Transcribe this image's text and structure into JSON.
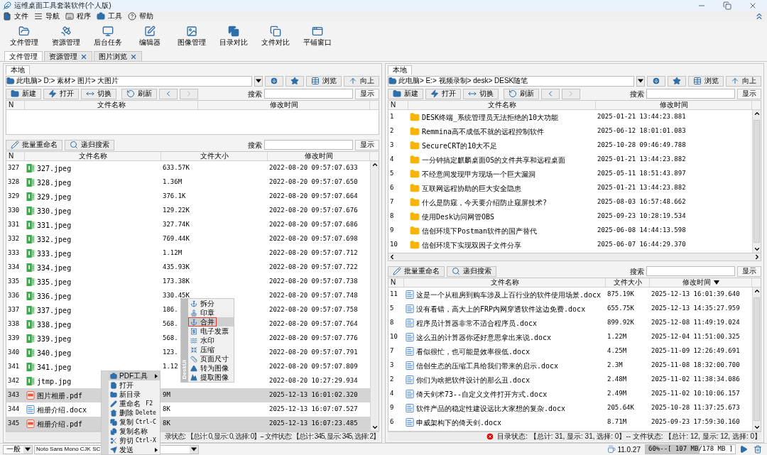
{
  "window": {
    "title": "运维桌面工具套装软件(个人版)"
  },
  "menu": [
    {
      "label": "文件",
      "kind": "file"
    },
    {
      "label": "导航",
      "kind": "nav"
    },
    {
      "label": "程序",
      "kind": "program"
    },
    {
      "label": "工具",
      "kind": "tools"
    },
    {
      "label": "帮助",
      "kind": "help"
    }
  ],
  "toolbar": [
    {
      "label": "文件管理",
      "kind": "folder"
    },
    {
      "label": "资源管理",
      "kind": "remote"
    },
    {
      "label": "后台任务",
      "kind": "monitor"
    },
    {
      "label": "编辑器",
      "kind": "editor"
    },
    {
      "label": "图像管理",
      "kind": "image"
    },
    {
      "label": "目录对比",
      "kind": "dircompare"
    },
    {
      "label": "文件对比",
      "kind": "filecompare"
    },
    {
      "label": "平铺窗口",
      "kind": "tile"
    }
  ],
  "tabs": [
    {
      "label": "文件管理",
      "selected": true,
      "closable": false
    },
    {
      "label": "资源管理",
      "selected": false,
      "closable": true
    },
    {
      "label": "图片浏览",
      "selected": false,
      "closable": true
    }
  ],
  "left_pane": {
    "tab": {
      "label": "本地",
      "selected": true
    },
    "path": "此电脑> D:> 素材> 图片> 大图片",
    "path_buttons": [
      {
        "label": "浏览",
        "kind": "browse"
      },
      {
        "label": "向上",
        "kind": "up"
      }
    ],
    "actions": [
      {
        "label": "新建",
        "kind": "new"
      },
      {
        "label": "打开",
        "kind": "open"
      },
      {
        "label": "切换",
        "kind": "switch"
      },
      {
        "label": "刷新",
        "kind": "refresh"
      }
    ],
    "nav": [
      {
        "kind": "back",
        "disabled": false
      },
      {
        "kind": "forward",
        "disabled": true
      }
    ],
    "search_label": "搜索",
    "show_button": "显示",
    "upper_table": {
      "columns": [
        {
          "label": "N",
          "kind": "n"
        },
        {
          "label": "文件名称",
          "kind": "name"
        },
        {
          "label": "修改时间",
          "kind": "time"
        }
      ]
    },
    "lower_tools": [
      {
        "label": "批量重命名",
        "kind": "rename"
      },
      {
        "label": "递归搜索",
        "kind": "search"
      }
    ],
    "lower_search_label": "搜索",
    "lower_show_button": "显示",
    "lower_table": {
      "columns": [
        {
          "label": "N",
          "kind": "n",
          "sorted": false
        },
        {
          "label": "文件名称",
          "kind": "name",
          "sorted": false
        },
        {
          "label": "文件大小",
          "kind": "size",
          "sorted": false
        },
        {
          "label": "修改时间",
          "kind": "time",
          "sorted": false
        }
      ],
      "rows": [
        {
          "n": "327",
          "name": "327.jpeg",
          "kind": "jpeg",
          "size": "633.57K",
          "time": "2022-08-20 09:57:07.633",
          "selected": false
        },
        {
          "n": "328",
          "name": "328.jpeg",
          "kind": "jpeg",
          "size": "1.36M",
          "time": "2022-08-20 09:57:07.650",
          "selected": false
        },
        {
          "n": "329",
          "name": "329.jpeg",
          "kind": "jpeg",
          "size": "376.1K",
          "time": "2022-08-20 09:57:07.664",
          "selected": false
        },
        {
          "n": "330",
          "name": "330.jpeg",
          "kind": "jpeg",
          "size": "129.22K",
          "time": "2022-08-20 09:57:07.676",
          "selected": false
        },
        {
          "n": "331",
          "name": "331.jpeg",
          "kind": "jpeg",
          "size": "327.74K",
          "time": "2022-08-20 09:57:07.686",
          "selected": false
        },
        {
          "n": "332",
          "name": "332.jpeg",
          "kind": "jpeg",
          "size": "769.44K",
          "time": "2022-08-20 09:57:07.698",
          "selected": false
        },
        {
          "n": "333",
          "name": "333.jpeg",
          "kind": "jpeg",
          "size": "1.12M",
          "time": "2022-08-20 09:57:07.712",
          "selected": false
        },
        {
          "n": "334",
          "name": "334.jpeg",
          "kind": "jpeg",
          "size": "435.93K",
          "time": "2022-08-20 09:57:07.722",
          "selected": false
        },
        {
          "n": "335",
          "name": "335.jpeg",
          "kind": "jpeg",
          "size": "173.38K",
          "time": "2022-08-20 09:57:07.738",
          "selected": false
        },
        {
          "n": "336",
          "name": "336.jpeg",
          "kind": "jpeg",
          "size": "330.45K",
          "time": "2022-08-20 09:57:07.748",
          "selected": false
        },
        {
          "n": "337",
          "name": "337.jpeg",
          "kind": "jpeg",
          "size": "186.",
          "time": "2022-08-20 09:57:07.758",
          "selected": false
        },
        {
          "n": "338",
          "name": "338.jpeg",
          "kind": "jpeg",
          "size": "568.",
          "time": "2022-08-20 09:57:07.764",
          "selected": false
        },
        {
          "n": "339",
          "name": "339.jpeg",
          "kind": "jpeg",
          "size": "568.",
          "time": "2022-08-20 09:57:07.776",
          "selected": false
        },
        {
          "n": "340",
          "name": "340.jpeg",
          "kind": "jpeg",
          "size": "123.",
          "time": "2022-08-20 09:57:07.791",
          "selected": false
        },
        {
          "n": "341",
          "name": "341.jpeg",
          "kind": "jpeg",
          "size": "1.12",
          "time": "2022-08-20 09:57:07.809",
          "selected": false
        },
        {
          "n": "342",
          "name": "jtmp.jpg",
          "kind": "jpeg",
          "time": "2022-08-20 10:27:29.934",
          "selected": false
        },
        {
          "n": "343",
          "name": "图片相册.pdf",
          "kind": "pdf",
          "size": "9M",
          "time": "2025-12-13 16:01:02.320",
          "selected": true
        },
        {
          "n": "344",
          "name": "相册介绍.docx",
          "kind": "docx",
          "size": "8K",
          "time": "2025-12-13 16:07:07.527",
          "selected": false
        },
        {
          "n": "345",
          "name": "相册介绍.pdf",
          "kind": "pdf",
          "size": "8K",
          "time": "2025-12-13 16:07:23.485",
          "selected": true
        }
      ]
    },
    "status": "录状态: 【总计: 0, 显示: 0, 选择: 0】-- 文件状态: 【总计: 345, 显示: 345, 选择: 2】",
    "status_error": false
  },
  "right_pane": {
    "tab": {
      "label": "本地",
      "selected": true
    },
    "path": "此电脑> E:> 视频录制> desk> DESK随笔",
    "path_buttons": [
      {
        "label": "浏览",
        "kind": "browse"
      },
      {
        "label": "向上",
        "kind": "up"
      }
    ],
    "actions": [
      {
        "label": "新建",
        "kind": "new"
      },
      {
        "label": "打开",
        "kind": "open"
      },
      {
        "label": "切换",
        "kind": "switch"
      },
      {
        "label": "刷新",
        "kind": "refresh"
      }
    ],
    "nav": [
      {
        "kind": "back",
        "disabled": false
      },
      {
        "kind": "forward",
        "disabled": true
      }
    ],
    "search_label": "搜索",
    "show_button": "显示",
    "upper_table": {
      "columns": [
        {
          "label": "N",
          "kind": "n"
        },
        {
          "label": "文件名称",
          "kind": "name"
        },
        {
          "label": "修改时间",
          "kind": "time"
        }
      ],
      "rows": [
        {
          "n": "1",
          "name": "DESK终端_系统管理员无法拒绝的10大功能",
          "kind": "folder",
          "time": "2025-01-21 13:44:23.881",
          "selected": false
        },
        {
          "n": "2",
          "name": "Remmina高不成低不就的远程控制软件",
          "kind": "folder",
          "time": "2025-06-12 18:01:01.083",
          "selected": false
        },
        {
          "n": "3",
          "name": "SecureCRT的10大不足",
          "kind": "folder",
          "time": "2025-10-28 09:46:49.788",
          "selected": false
        },
        {
          "n": "4",
          "name": "一分钟搞定麒麟桌面OS的文件共享和远程桌面",
          "kind": "folder",
          "time": "2025-01-21 13:44:23.882",
          "selected": false
        },
        {
          "n": "5",
          "name": "不经意间发现甲方现场一个巨大漏洞",
          "kind": "folder",
          "time": "2025-05-11 18:51:43.897",
          "selected": false
        },
        {
          "n": "6",
          "name": "互联网远程协助的巨大安全隐患",
          "kind": "folder",
          "time": "2025-01-21 13:44:23.882",
          "selected": false
        },
        {
          "n": "7",
          "name": "什么是防窥，今天要介绍防止窥屏技术?",
          "kind": "folder",
          "time": "2025-08-03 16:57:48.662",
          "selected": false
        },
        {
          "n": "8",
          "name": "使用Desk访问网管OBS",
          "kind": "folder",
          "time": "2025-09-23 10:28:19.534",
          "selected": false
        },
        {
          "n": "9",
          "name": "信创环境下Postman软件的国产替代",
          "kind": "folder",
          "time": "2025-06-08 14:44:13.598",
          "selected": false
        },
        {
          "n": "10",
          "name": "信创环境下实现双因子文件分享",
          "kind": "folder",
          "time": "2025-06-07 16:44:29.370",
          "selected": false
        }
      ]
    },
    "lower_tools": [
      {
        "label": "批量重命名",
        "kind": "rename"
      },
      {
        "label": "递归搜索",
        "kind": "search"
      }
    ],
    "lower_search_label": "搜索",
    "lower_show_button": "显示",
    "lower_table": {
      "columns": [
        {
          "label": "N",
          "kind": "n",
          "sorted": false
        },
        {
          "label": "文件名称",
          "kind": "name",
          "sorted": false
        },
        {
          "label": "文件大小",
          "kind": "size",
          "sorted": false
        },
        {
          "label": "修改时间",
          "kind": "time",
          "sorted": true
        }
      ],
      "rows": [
        {
          "n": "11",
          "name": "这是一个从租房到购车涉及上百行业的软件使用场景.docx",
          "kind": "docx",
          "size": "875.19K",
          "time": "2025-12-13 16:01:39.640",
          "selected": false
        },
        {
          "n": "5",
          "name": "没有看错，高大上的FRP内网穿透软件这边免费.docx",
          "kind": "docx",
          "size": "655.75K",
          "time": "2025-12-13 14:35:27.959",
          "selected": false
        },
        {
          "n": "8",
          "name": "程序员计算器非常不适合程序员.docx",
          "kind": "docx",
          "size": "899.92K",
          "time": "2025-12-08 11:49:19.024",
          "selected": false
        },
        {
          "n": "10",
          "name": "这么丑的计算器你还好意思拿出来说.docx",
          "kind": "docx",
          "size": "1.22M",
          "time": "2025-12-04 11:51:00.325",
          "selected": false
        },
        {
          "n": "7",
          "name": "看似很忙，也可能是效率很低.docx",
          "kind": "docx",
          "size": "4.25M",
          "time": "2025-11-09 12:26:49.691",
          "selected": false
        },
        {
          "n": "3",
          "name": "信创生态的压缩工具给我们带来的启示.docx",
          "kind": "docx",
          "size": "2.3M",
          "time": "2025-11-08 18:32:00.700",
          "selected": false
        },
        {
          "n": "2",
          "name": "你们为啥把软件设计的那么丑.docx",
          "kind": "docx",
          "size": "2.48M",
          "time": "2025-11-02 11:38:34.086",
          "selected": false
        },
        {
          "n": "4",
          "name": "倚天剑术73--自定义文件打开方式.docx",
          "kind": "docx",
          "size": "2.49M",
          "time": "2025-11-02 10:10:06.157",
          "selected": false
        },
        {
          "n": "9",
          "name": "软件产品的稳定性建设远比大家想的复杂.docx",
          "kind": "docx",
          "size": "205.64K",
          "time": "2025-10-28 11:37:25.673",
          "selected": false
        },
        {
          "n": "6",
          "name": "申威架构下的倚天剑.docx",
          "kind": "docx",
          "size": "8.71M",
          "time": "2025-09-23 17:59:30.160",
          "selected": false
        }
      ]
    },
    "status": "目录状态: 【总计: 31, 显示: 31, 选择: 0】-- 文件状态: 【总计: 12, 显示: 12, 选择: 0】",
    "status_error": true
  },
  "context_menu": {
    "items": [
      {
        "label": "PDF工具",
        "kind": "toolbox",
        "submenu": true,
        "selected": true
      },
      {
        "label": "打开",
        "kind": "open",
        "submenu": false,
        "selected": false
      },
      {
        "label": "新目录",
        "kind": "newdir",
        "submenu": false,
        "selected": false
      },
      {
        "label": "重命名",
        "kind": "rename",
        "shortcut": "F2",
        "submenu": false,
        "selected": false
      },
      {
        "label": "删除",
        "kind": "delete",
        "shortcut": "Delete",
        "submenu": false,
        "selected": false
      },
      {
        "label": "复制",
        "kind": "copy",
        "shortcut": "Ctrl-C",
        "submenu": false,
        "selected": false
      },
      {
        "label": "复制名称",
        "kind": "copyname",
        "submenu": false,
        "selected": false
      },
      {
        "label": "剪切",
        "kind": "cut",
        "shortcut": "Ctrl-X",
        "submenu": false,
        "selected": false
      },
      {
        "label": "发送",
        "kind": "send",
        "submenu": true,
        "selected": false
      }
    ]
  },
  "submenu": {
    "side_label": "DeskUI",
    "items": [
      {
        "label": "拆分",
        "kind": "split",
        "selected": false
      },
      {
        "label": "印章",
        "kind": "stamp",
        "selected": false
      },
      {
        "label": "合并",
        "kind": "merge",
        "selected": true
      },
      {
        "label": "电子发票",
        "kind": "invoice",
        "selected": false
      },
      {
        "label": "水印",
        "kind": "watermark",
        "selected": false
      },
      {
        "label": "压缩",
        "kind": "compress",
        "selected": false
      },
      {
        "label": "页面尺寸",
        "kind": "pagesize",
        "selected": false
      },
      {
        "label": "转为图像",
        "kind": "toimage",
        "selected": false
      },
      {
        "label": "提取图像",
        "kind": "extract",
        "selected": false
      }
    ]
  },
  "bottom_bar": {
    "style_select": "一般",
    "font_field": "Noto Sans Mono CJK SC",
    "version": "11.0.27",
    "memory": {
      "text": "60%--[ 107 MB/178 MB ]",
      "level": 0.6
    }
  }
}
